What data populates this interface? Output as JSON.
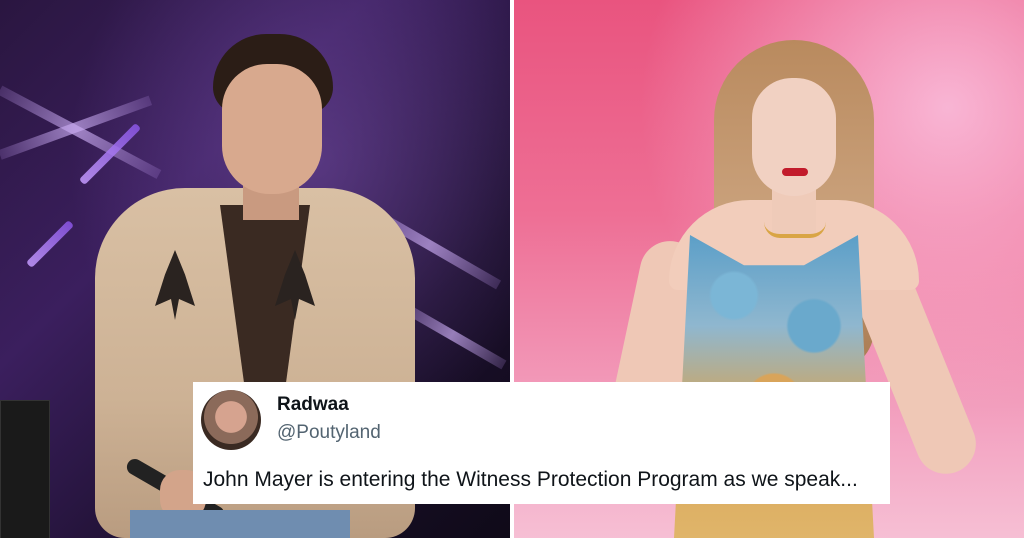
{
  "tweet": {
    "display_name": "Radwaa",
    "handle": "@Poutyland",
    "text": "John Mayer is entering the Witness Protection Program as we speak...",
    "avatar_icon": "user-avatar"
  },
  "photos": {
    "left_subject": "man-on-stage-photo",
    "right_subject": "woman-performer-photo"
  },
  "colors": {
    "tweet_bg": "#ffffff",
    "name_color": "#0f1419",
    "handle_color": "#536471",
    "left_bg": "#3b1f5e",
    "right_bg": "#ee6f95"
  }
}
